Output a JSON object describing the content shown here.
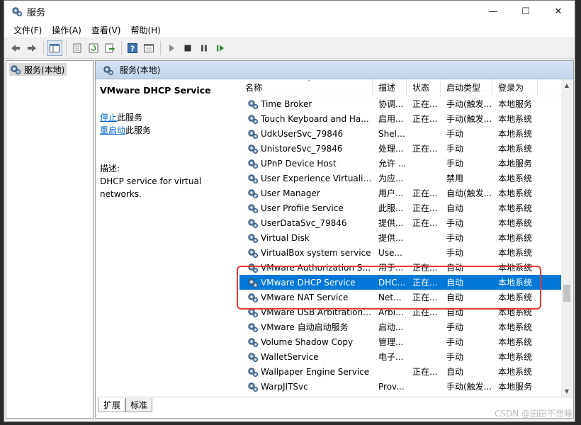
{
  "window": {
    "title": "服务",
    "controls": [
      "—",
      "☐",
      "✕"
    ]
  },
  "menu": [
    "文件(F)",
    "操作(A)",
    "查看(V)",
    "帮助(H)"
  ],
  "tree": {
    "item": "服务(本地)"
  },
  "main": {
    "header": "服务(本地)",
    "detail": {
      "title": "VMware DHCP Service",
      "stop_link": "停止",
      "stop_suffix": "此服务",
      "restart_link": "重启动",
      "restart_suffix": "此服务",
      "desc_label": "描述:",
      "desc_text": "DHCP service for virtual networks."
    }
  },
  "columns": [
    "名称",
    "描述",
    "状态",
    "启动类型",
    "登录为"
  ],
  "rows": [
    [
      "Time Broker",
      "协调...",
      "正在...",
      "手动(触发...",
      "本地服务"
    ],
    [
      "Touch Keyboard and Ha...",
      "启用...",
      "正在...",
      "手动(触发...",
      "本地系统"
    ],
    [
      "UdkUserSvc_79846",
      "Shell...",
      "",
      "手动",
      "本地系统"
    ],
    [
      "UnistoreSvc_79846",
      "处理...",
      "正在...",
      "手动",
      "本地系统"
    ],
    [
      "UPnP Device Host",
      "允许 ...",
      "",
      "手动",
      "本地服务"
    ],
    [
      "User Experience Virtualiz...",
      "为应...",
      "",
      "禁用",
      "本地系统"
    ],
    [
      "User Manager",
      "用户...",
      "正在...",
      "自动(触发...",
      "本地系统"
    ],
    [
      "User Profile Service",
      "此服...",
      "正在...",
      "自动",
      "本地系统"
    ],
    [
      "UserDataSvc_79846",
      "提供...",
      "正在...",
      "手动",
      "本地系统"
    ],
    [
      "Virtual Disk",
      "提供...",
      "",
      "手动",
      "本地系统"
    ],
    [
      "VirtualBox system service",
      "Use...",
      "",
      "手动",
      "本地系统"
    ],
    [
      "VMware Authorization Se...",
      "用于...",
      "正在...",
      "自动",
      "本地系统"
    ],
    [
      "VMware DHCP Service",
      "DHC...",
      "正在...",
      "自动",
      "本地系统"
    ],
    [
      "VMware NAT Service",
      "Net...",
      "正在...",
      "自动",
      "本地系统"
    ],
    [
      "VMware USB Arbitration ...",
      "Arbit...",
      "正在...",
      "自动",
      "本地系统"
    ],
    [
      "VMware 自动启动服务",
      "启动...",
      "",
      "手动",
      "本地系统"
    ],
    [
      "Volume Shadow Copy",
      "管理...",
      "",
      "手动",
      "本地系统"
    ],
    [
      "WalletService",
      "电子...",
      "",
      "手动",
      "本地系统"
    ],
    [
      "Wallpaper Engine Service",
      "",
      "正在...",
      "自动",
      "本地系统"
    ],
    [
      "WarpJITSvc",
      "Prov...",
      "",
      "手动(触发...",
      "本地服务"
    ]
  ],
  "selected_row": "VMware DHCP Service",
  "tabs": [
    "扩展",
    "标准"
  ],
  "watermark": "CSDN @田田不想睡",
  "colors": {
    "selection": "#0078d7",
    "highlight_box": "#e53935",
    "link": "#0066cc"
  },
  "icons": [
    "services-icon",
    "back-icon",
    "forward-icon",
    "console-tree-icon",
    "properties-icon",
    "refresh-icon",
    "export-icon",
    "help-icon",
    "view-icon",
    "play-icon",
    "stop-icon",
    "pause-icon",
    "resume-icon",
    "gear-icon"
  ]
}
